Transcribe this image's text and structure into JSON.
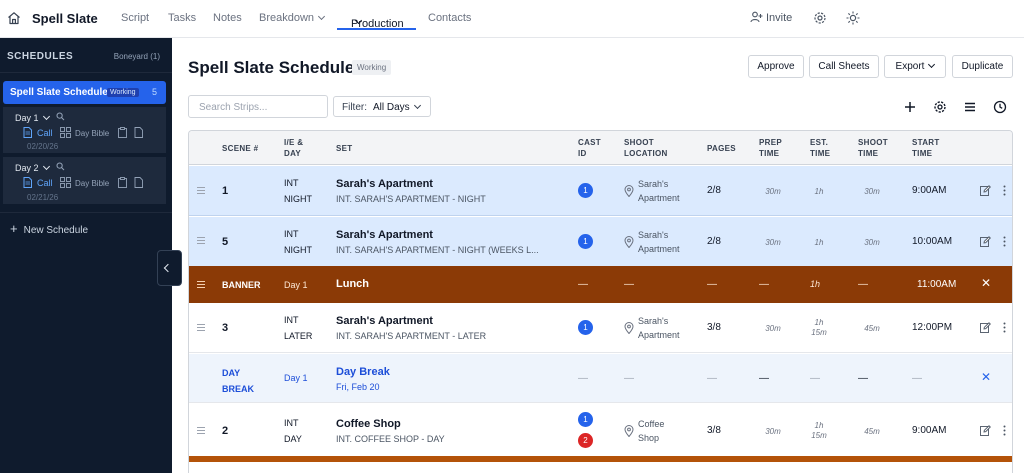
{
  "topbar": {
    "brand": "Spell Slate",
    "nav": [
      "Script",
      "Tasks",
      "Notes",
      "Breakdown",
      "Production",
      "Contacts"
    ],
    "invite": "Invite"
  },
  "sidebar": {
    "heading": "SCHEDULES",
    "boneyard": "Boneyard (1)",
    "schedule": {
      "name": "Spell Slate Schedule",
      "badge": "Working",
      "count": "5"
    },
    "days": [
      {
        "label": "Day 1",
        "call": "Call",
        "bible": "Day Bible",
        "date": "02/20/26"
      },
      {
        "label": "Day 2",
        "call": "Call",
        "bible": "Day Bible",
        "date": "02/21/26"
      }
    ],
    "new_schedule": "New Schedule"
  },
  "main": {
    "title": "Spell Slate Schedule",
    "badge": "Working",
    "buttons": {
      "approve": "Approve",
      "call_sheets": "Call Sheets",
      "export": "Export",
      "duplicate": "Duplicate"
    },
    "search_placeholder": "Search Strips...",
    "filter_label": "Filter:",
    "filter_value": "All Days"
  },
  "table": {
    "headers": {
      "scene": "SCENE #",
      "ie1": "I/E &",
      "ie2": "DAY",
      "set": "SET",
      "cast1": "CAST",
      "cast2": "ID",
      "loc1": "SHOOT",
      "loc2": "LOCATION",
      "pages": "PAGES",
      "prep1": "PREP",
      "prep2": "TIME",
      "est1": "EST.",
      "est2": "TIME",
      "shoot1": "SHOOT",
      "shoot2": "TIME",
      "start1": "START",
      "start2": "TIME"
    },
    "rows": [
      {
        "scene": "1",
        "ie": "INT",
        "time": "NIGHT",
        "set": "Sarah's Apartment",
        "sub": "INT. SARAH'S APARTMENT - NIGHT",
        "cast": "1",
        "loc1": "Sarah's",
        "loc2": "Apartment",
        "pages": "2/8",
        "prep": "30m",
        "est": "1h",
        "shoot": "30m",
        "start": "9:00AM"
      },
      {
        "scene": "5",
        "ie": "INT",
        "time": "NIGHT",
        "set": "Sarah's Apartment",
        "sub": "INT. SARAH'S APARTMENT - NIGHT (WEEKS L...",
        "cast": "1",
        "loc1": "Sarah's",
        "loc2": "Apartment",
        "pages": "2/8",
        "prep": "30m",
        "est": "1h",
        "shoot": "30m",
        "start": "10:00AM"
      },
      {
        "scene": "3",
        "ie": "INT",
        "time": "LATER",
        "set": "Sarah's Apartment",
        "sub": "INT. SARAH'S APARTMENT - LATER",
        "cast": "1",
        "loc1": "Sarah's",
        "loc2": "Apartment",
        "pages": "3/8",
        "prep": "30m",
        "est1": "1h",
        "est2": "15m",
        "shoot": "45m",
        "start": "12:00PM"
      },
      {
        "scene": "2",
        "ie": "INT",
        "time": "DAY",
        "set": "Coffee Shop",
        "sub": "INT. COFFEE SHOP - DAY",
        "cast1": "1",
        "cast2": "2",
        "loc1": "Coffee",
        "loc2": "Shop",
        "pages": "3/8",
        "prep": "30m",
        "est1": "1h",
        "est2": "15m",
        "shoot": "45m",
        "start": "9:00AM"
      }
    ],
    "banner": {
      "label": "BANNER",
      "day": "Day 1",
      "title": "Lunch",
      "dash": "—",
      "est": "1h",
      "start": "11:00AM"
    },
    "daybreak": {
      "label1": "DAY",
      "label2": "BREAK",
      "day": "Day 1",
      "title": "Day Break",
      "date": "Fri, Feb 20",
      "dash": "—"
    }
  },
  "colors": {
    "accent": "#2563eb",
    "banner": "#8b3a06",
    "selected_row": "#dbeafe",
    "daybreak_row": "#eef4fc"
  }
}
